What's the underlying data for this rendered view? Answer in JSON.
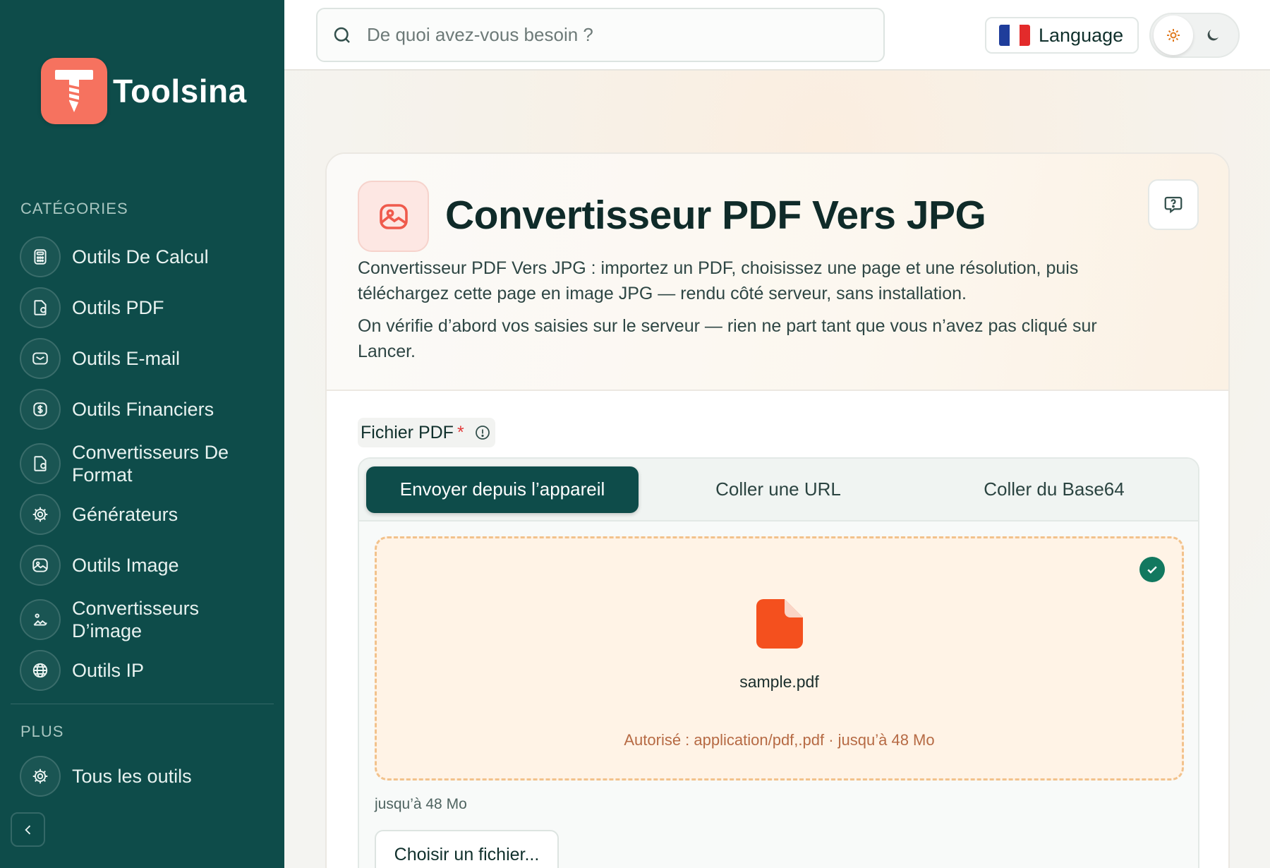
{
  "brand": {
    "name": "Toolsina"
  },
  "sidebar": {
    "categories_label": "CATÉGORIES",
    "items": [
      {
        "label": "Outils De Calcul",
        "icon": "calculator-icon"
      },
      {
        "label": "Outils PDF",
        "icon": "file-icon"
      },
      {
        "label": "Outils E-mail",
        "icon": "mail-icon"
      },
      {
        "label": "Outils Financiers",
        "icon": "dollar-icon"
      },
      {
        "label": "Convertisseurs De Format",
        "icon": "file-convert-icon"
      },
      {
        "label": "Générateurs",
        "icon": "cog-icon"
      },
      {
        "label": "Outils Image",
        "icon": "image-icon"
      },
      {
        "label": "Convertisseurs D’image",
        "icon": "image-convert-icon"
      },
      {
        "label": "Outils IP",
        "icon": "globe-icon"
      }
    ],
    "more_label": "PLUS",
    "more_items": [
      {
        "label": "Tous les outils",
        "icon": "cog-icon"
      }
    ]
  },
  "search": {
    "placeholder": "De quoi avez-vous besoin ?"
  },
  "language": {
    "label": "Language",
    "flag_colors": [
      "#1f3d9b",
      "#ffffff",
      "#e32b2b"
    ]
  },
  "theme": {
    "active": "light"
  },
  "tool": {
    "title": "Convertisseur PDF Vers JPG",
    "description_1": "Convertisseur PDF Vers JPG : importez un PDF, choisissez une page et une résolution, puis téléchargez cette page en image JPG — rendu côté serveur, sans installation.",
    "description_2": "On vérifie d’abord vos saisies sur le serveur — rien ne part tant que vous n’avez pas cliqué sur Lancer."
  },
  "field": {
    "label": "Fichier PDF",
    "required_mark": "*"
  },
  "tabs": [
    {
      "label": "Envoyer depuis l’appareil",
      "active": true
    },
    {
      "label": "Coller une URL",
      "active": false
    },
    {
      "label": "Coller du Base64",
      "active": false
    }
  ],
  "dropzone": {
    "file_name": "sample.pdf",
    "allowed_text": "Autorisé : application/pdf,.pdf · jusqu’à 48 Mo"
  },
  "limit_text": "jusqu’à 48 Mo",
  "choose_button": "Choisir un fichier...",
  "colors": {
    "sidebar": "#0e4c4a",
    "accent_coral": "#f6725f",
    "file_orange": "#f4501e",
    "success_green": "#12785f"
  }
}
